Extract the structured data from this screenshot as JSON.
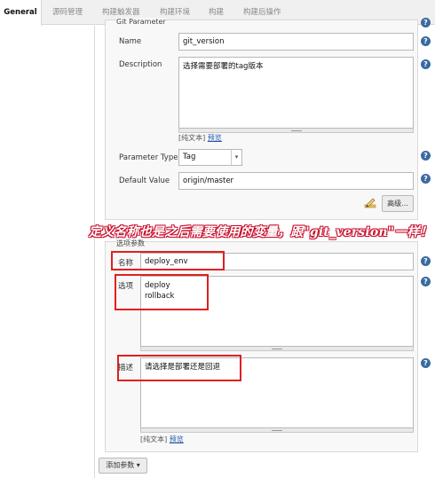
{
  "tabs": [
    {
      "label": "General"
    },
    {
      "label": "源码管理"
    },
    {
      "label": "构建触发器"
    },
    {
      "label": "构建环境"
    },
    {
      "label": "构建"
    },
    {
      "label": "构建后操作"
    }
  ],
  "git_parameter": {
    "title": "Git Parameter",
    "name_label": "Name",
    "name_value": "git_version",
    "description_label": "Description",
    "description_value": "选择需要部署的tag版本",
    "plain_text": "[纯文本]",
    "preview": "预览",
    "type_label": "Parameter Type",
    "type_value": "Tag",
    "default_label": "Default Value",
    "default_value": "origin/master",
    "advanced_button": "高级..."
  },
  "annotation": {
    "banner": "定义名称也是之后需要使用的变量，跟\"git_version\"一样！"
  },
  "choice_parameter": {
    "title": "选项参数",
    "name_label": "名称",
    "name_value": "deploy_env",
    "choices_label": "选项",
    "choices_value": [
      "deploy",
      "rollback"
    ],
    "description_label": "描述",
    "description_value": "请选择是部署还是回退",
    "plain_text": "[纯文本]",
    "preview": "预览"
  },
  "footer": {
    "add_param_button": "添加参数 ▾"
  },
  "help_icon": "?"
}
